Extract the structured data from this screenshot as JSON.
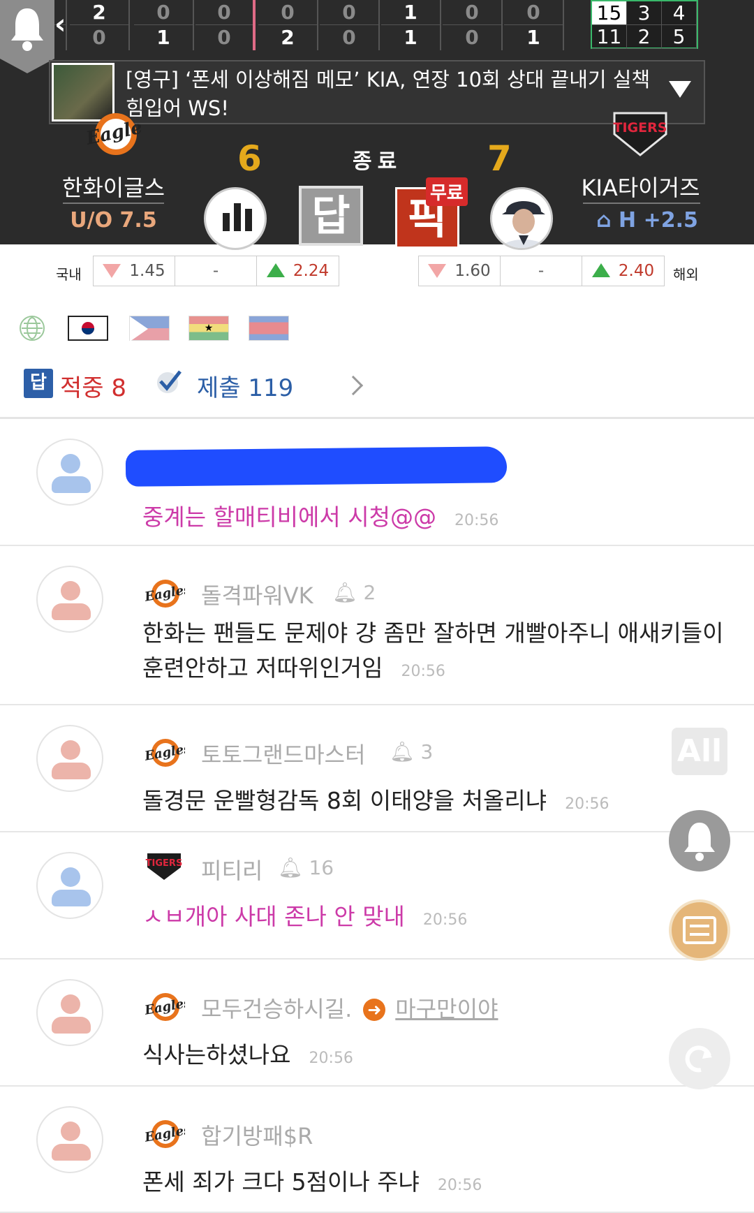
{
  "scoreboard": {
    "innings": [
      {
        "top": "2",
        "bottom": "0"
      },
      {
        "top": "2",
        "bottom": "0"
      },
      {
        "top": "0",
        "bottom": "1"
      },
      {
        "top": "0",
        "bottom": "0"
      },
      {
        "top": "0",
        "bottom": "2"
      },
      {
        "top": "0",
        "bottom": "0"
      },
      {
        "top": "1",
        "bottom": "1"
      },
      {
        "top": "0",
        "bottom": "0"
      },
      {
        "top": "0",
        "bottom": "1"
      }
    ],
    "rhe": {
      "away": [
        "15",
        "3",
        "4"
      ],
      "home": [
        "11",
        "2",
        "5"
      ]
    }
  },
  "news": {
    "headline": "[영구] ‘폰세 이상해짐 메모’ KIA, 연장 10회 상대 끝내기 실책 힘입어 WS!"
  },
  "game": {
    "status": "종료",
    "away": {
      "name": "한화이글스",
      "score": "6",
      "sub": "U/O 7.5",
      "logo_text": "Eagles"
    },
    "home": {
      "name": "KIA타이거즈",
      "score": "7",
      "sub": "H +2.5",
      "logo_text": "TIGERS"
    },
    "answer_label": "답",
    "pick_label": "픽",
    "free_badge": "무료"
  },
  "odds": {
    "domestic_label": "국내",
    "overseas_label": "해외",
    "domestic": [
      "1.45",
      "-",
      "2.24"
    ],
    "overseas": [
      "1.60",
      "-",
      "2.40"
    ]
  },
  "stats": {
    "hit_icon": "답",
    "hit_label": "적중 8",
    "submit_label": "제출 119"
  },
  "comments": [
    {
      "user": "",
      "text": "중계는 할매티비에서 시청@@",
      "time": "20:56"
    },
    {
      "user": "돌격파워VK",
      "bell": "2",
      "text_line1": "한화는 팬들도 문제야 걍 좀만 잘하면 개빨아주니 애새키들이",
      "text_line2": "훈련안하고 저따위인거임",
      "time": "20:56"
    },
    {
      "user": "토토그랜드마스터",
      "bell": "3",
      "text": "돌경문 운빨형감독 8회 이태양을 처올리냐",
      "time": "20:56"
    },
    {
      "user": "피티리",
      "bell": "16",
      "text": "ㅅㅂ개아 사대 존나 안 맞내",
      "time": "20:56"
    },
    {
      "user": "모두건승하시길.",
      "mention": "마구만이야",
      "text": "식사는하셨나요",
      "time": "20:56"
    },
    {
      "user": "합기방패$R",
      "text": "폰세 죄가 크다 5점이나 주냐",
      "time": "20:56"
    }
  ],
  "floating": {
    "all_label": "All"
  },
  "colors": {
    "header_bg": "#2b2b2b",
    "score": "#e5a91c",
    "hit": "#d12f2f",
    "submit": "#2b5ea6",
    "pink_text": "#cc3aa8",
    "pick": "#c0341c"
  }
}
